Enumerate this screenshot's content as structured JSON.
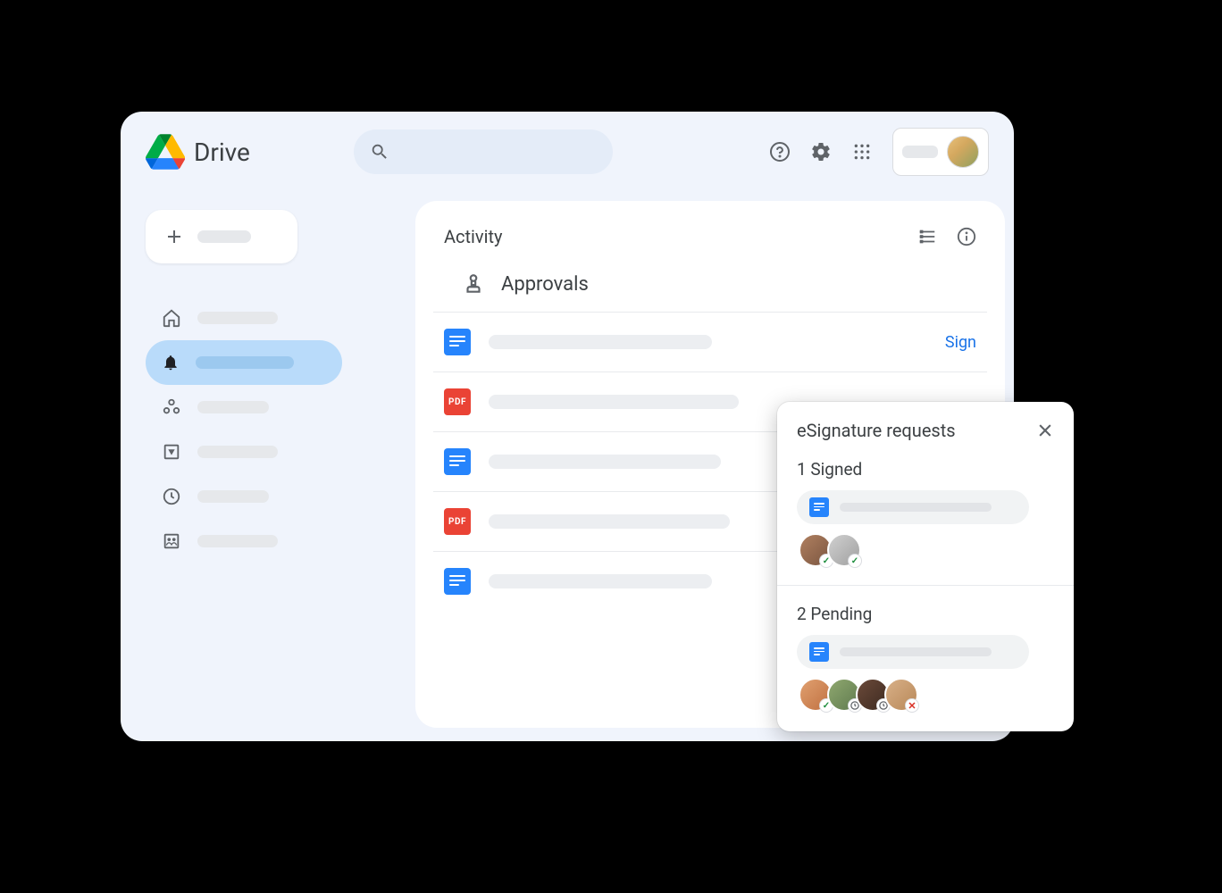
{
  "app": {
    "title": "Drive"
  },
  "header": {
    "search_placeholder": "",
    "icons": {
      "help": "help",
      "settings": "settings",
      "apps": "apps"
    }
  },
  "sidebar": {
    "new_label": "",
    "items": [
      {
        "icon": "home",
        "label": ""
      },
      {
        "icon": "bell",
        "label": "",
        "active": true
      },
      {
        "icon": "shared",
        "label": ""
      },
      {
        "icon": "drive",
        "label": ""
      },
      {
        "icon": "clock",
        "label": ""
      },
      {
        "icon": "people",
        "label": ""
      }
    ]
  },
  "panel": {
    "title": "Activity",
    "section_title": "Approvals",
    "action_label": "Sign",
    "rows": [
      {
        "type": "docs"
      },
      {
        "type": "pdf"
      },
      {
        "type": "docs"
      },
      {
        "type": "pdf"
      },
      {
        "type": "docs"
      }
    ]
  },
  "popup": {
    "title": "eSignature requests",
    "sections": [
      {
        "title": "1 Signed",
        "doc_type": "docs",
        "people": [
          {
            "status": "check"
          },
          {
            "status": "check"
          }
        ]
      },
      {
        "title": "2 Pending",
        "doc_type": "docs",
        "people": [
          {
            "status": "check"
          },
          {
            "status": "clock"
          },
          {
            "status": "clock"
          },
          {
            "status": "x"
          }
        ]
      }
    ]
  }
}
